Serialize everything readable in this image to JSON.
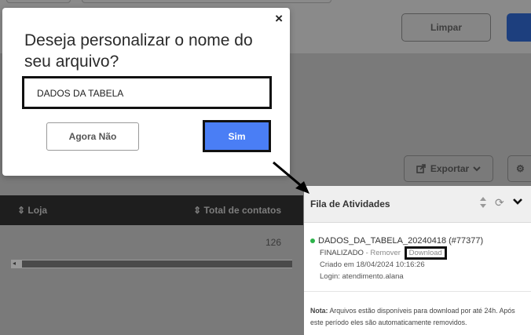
{
  "background": {
    "limpar_label": "Limpar",
    "exportar_label": "Exportar",
    "table": {
      "col_loja": "Loja",
      "col_total": "Total de contatos",
      "row_total_value": "126"
    }
  },
  "activity_panel": {
    "title": "Fila de Atividades",
    "job": {
      "filename": "DADOS_DA_TABELA_20240418 (#77377)",
      "status": "FINALIZADO",
      "separator": " - ",
      "remove_label": "Remover",
      "download_label": "Download",
      "created": "Criado em 18/04/2024 10:16:26",
      "login": "Login: atendimento.alana",
      "status_color": "#2db34a"
    },
    "note_label": "Nota:",
    "note_text": " Arquivos estão disponíveis para download por até 24h. Após este período eles são automaticamente removidos."
  },
  "modal": {
    "title": "Deseja personalizar o nome do seu arquivo?",
    "input_value": "DADOS DA TABELA",
    "cancel_label": "Agora Não",
    "confirm_label": "Sim",
    "confirm_color": "#4a7ef5"
  },
  "icons": {
    "close": "close-icon",
    "sort": "sort-icon",
    "refresh": "refresh-icon",
    "collapse": "chevron-down-icon",
    "export": "export-icon",
    "gear": "gear-icon"
  }
}
